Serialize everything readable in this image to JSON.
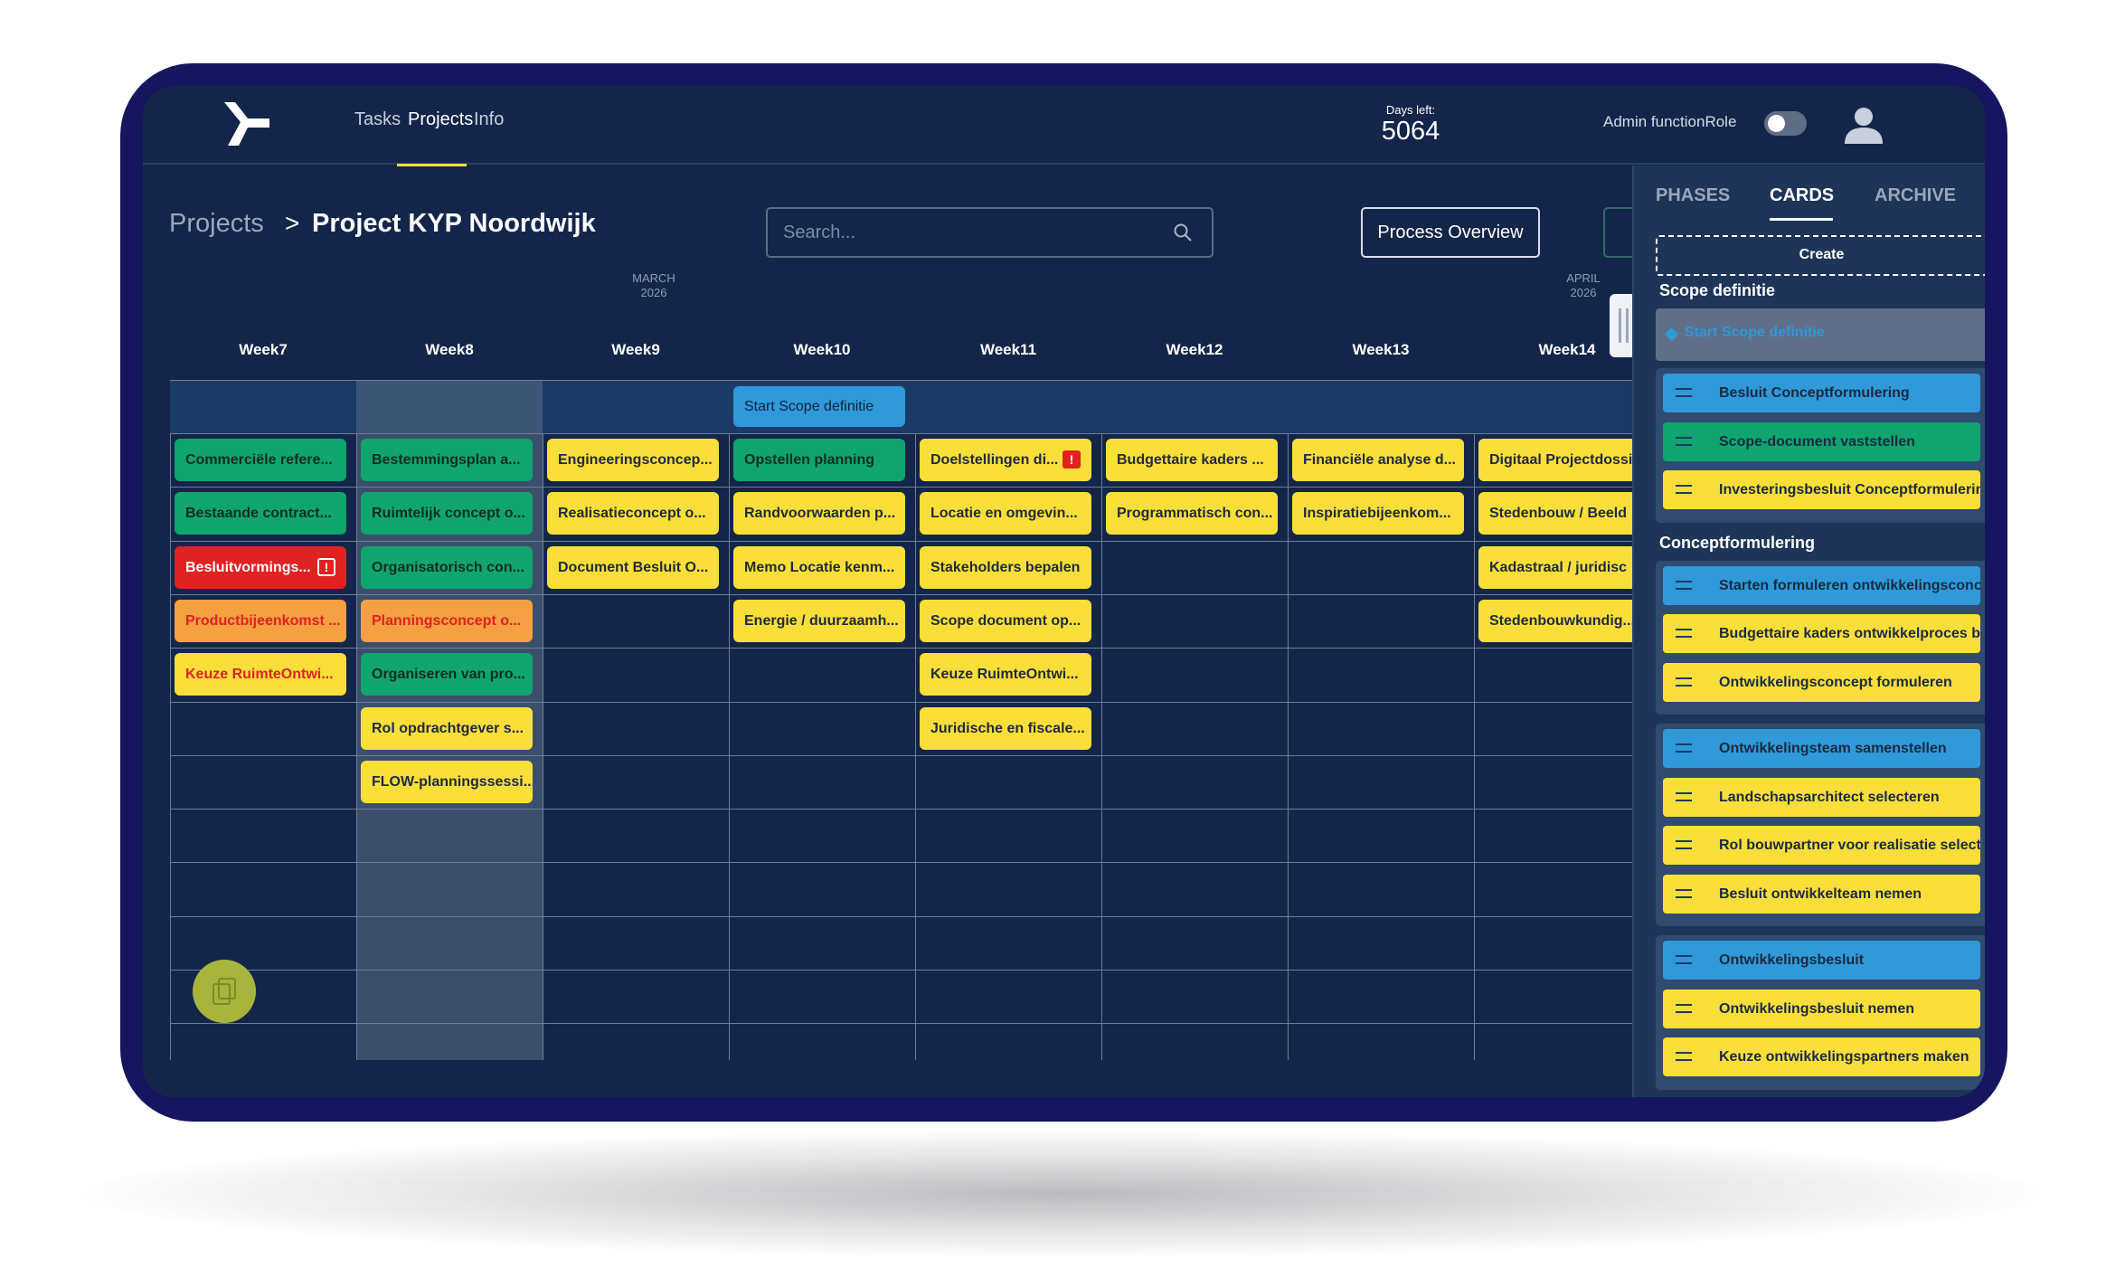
{
  "nav": {
    "tasks": "Tasks",
    "projects": "Projects",
    "info": "Info"
  },
  "days": {
    "label": "Days left:",
    "value": "5064"
  },
  "admin": {
    "label": "Admin functionRole",
    "toggle_on": false
  },
  "breadcrumb": {
    "root": "Projects",
    "separator": ">",
    "current": "Project KYP Noordwijk"
  },
  "search": {
    "placeholder": "Search..."
  },
  "process_overview": "Process Overview",
  "months": [
    {
      "name": "MARCH",
      "year": "2026"
    },
    {
      "name": "APRIL",
      "year": "2026"
    }
  ],
  "weeks": [
    "Week7",
    "Week8",
    "Week9",
    "Week10",
    "Week11",
    "Week12",
    "Week13",
    "Week14"
  ],
  "phase_cards": [
    {
      "week": "Week10",
      "label": "Start Scope definitie",
      "color": "blue"
    }
  ],
  "cards": [
    {
      "week": "Week7",
      "label": "Commerciële refere...",
      "color": "green"
    },
    {
      "week": "Week7",
      "label": "Bestaande contract...",
      "color": "green"
    },
    {
      "week": "Week7",
      "label": "Besluitvormings...",
      "color": "red",
      "alert": "!"
    },
    {
      "week": "Week7",
      "label": "Productbijeenkomst ...",
      "color": "orange"
    },
    {
      "week": "Week7",
      "label": "Keuze RuimteOntwi...",
      "color": "yellowred"
    },
    {
      "week": "Week8",
      "label": "Bestemmingsplan a...",
      "color": "green"
    },
    {
      "week": "Week8",
      "label": "Ruimtelijk concept o...",
      "color": "green"
    },
    {
      "week": "Week8",
      "label": "Organisatorisch con...",
      "color": "green"
    },
    {
      "week": "Week8",
      "label": "Planningsconcept o...",
      "color": "orange"
    },
    {
      "week": "Week8",
      "label": "Organiseren van pro...",
      "color": "green"
    },
    {
      "week": "Week8",
      "label": "Rol opdrachtgever s...",
      "color": "yellow"
    },
    {
      "week": "Week8",
      "label": "FLOW-planningssessi...",
      "color": "yellow"
    },
    {
      "week": "Week9",
      "label": "Engineeringsconcep...",
      "color": "yellow"
    },
    {
      "week": "Week9",
      "label": "Realisatieconcept o...",
      "color": "yellow"
    },
    {
      "week": "Week9",
      "label": "Document Besluit O...",
      "color": "yellow"
    },
    {
      "week": "Week10",
      "label": "Opstellen planning",
      "color": "green"
    },
    {
      "week": "Week10",
      "label": "Randvoorwaarden p...",
      "color": "yellow"
    },
    {
      "week": "Week10",
      "label": "Memo Locatie kenm...",
      "color": "yellow"
    },
    {
      "week": "Week10",
      "label": "Energie / duurzaamh...",
      "color": "yellow"
    },
    {
      "week": "Week11",
      "label": "Doelstellingen di...",
      "color": "yellow",
      "alert": "!"
    },
    {
      "week": "Week11",
      "label": "Locatie en omgevin...",
      "color": "yellow"
    },
    {
      "week": "Week11",
      "label": "Stakeholders bepalen",
      "color": "yellow"
    },
    {
      "week": "Week11",
      "label": "Scope document op...",
      "color": "yellow"
    },
    {
      "week": "Week11",
      "label": "Keuze RuimteOntwi...",
      "color": "yellow"
    },
    {
      "week": "Week11",
      "label": "Juridische en fiscale...",
      "color": "yellow"
    },
    {
      "week": "Week12",
      "label": "Budgettaire kaders ...",
      "color": "yellow"
    },
    {
      "week": "Week12",
      "label": "Programmatisch con...",
      "color": "yellow"
    },
    {
      "week": "Week13",
      "label": "Financiële analyse d...",
      "color": "yellow"
    },
    {
      "week": "Week13",
      "label": "Inspiratiebijeenkom...",
      "color": "yellow"
    },
    {
      "week": "Week14",
      "label": "Digitaal Projectdossi",
      "color": "yellow"
    },
    {
      "week": "Week14",
      "label": "Stedenbouw / Beeld",
      "color": "yellow"
    },
    {
      "week": "Week14",
      "label": "Kadastraal / juridisc",
      "color": "yellow"
    },
    {
      "week": "Week14",
      "label": "Stedenbouwkundig...",
      "color": "yellow"
    }
  ],
  "panel": {
    "tabs": [
      "PHASES",
      "CARDS",
      "ARCHIVE"
    ],
    "active_tab": "CARDS",
    "create": "Create",
    "sections": [
      {
        "title": "Scope definitie",
        "phase": "Start Scope definitie",
        "groups": [
          [
            {
              "label": "Besluit Conceptformulering",
              "color": "blue"
            },
            {
              "label": "Scope-document vaststellen",
              "color": "green"
            },
            {
              "label": "Investeringsbesluit Conceptformulering",
              "color": "yellow"
            }
          ]
        ]
      },
      {
        "title": "Conceptformulering",
        "groups": [
          [
            {
              "label": "Starten formuleren ontwikkelingsconcept",
              "color": "blue"
            },
            {
              "label": "Budgettaire kaders ontwikkelproces bepalen",
              "color": "yellow"
            },
            {
              "label": "Ontwikkelingsconcept formuleren",
              "color": "yellow"
            }
          ],
          [
            {
              "label": "Ontwikkelingsteam samenstellen",
              "color": "blue"
            },
            {
              "label": "Landschapsarchitect selecteren",
              "color": "yellow"
            },
            {
              "label": "Rol bouwpartner voor realisatie selecteren",
              "color": "yellow"
            },
            {
              "label": "Besluit ontwikkelteam nemen",
              "color": "yellow"
            }
          ],
          [
            {
              "label": "Ontwikkelingsbesluit",
              "color": "blue"
            },
            {
              "label": "Ontwikkelingsbesluit nemen",
              "color": "yellow"
            },
            {
              "label": "Keuze ontwikkelingspartners maken",
              "color": "yellow"
            }
          ]
        ]
      }
    ]
  }
}
